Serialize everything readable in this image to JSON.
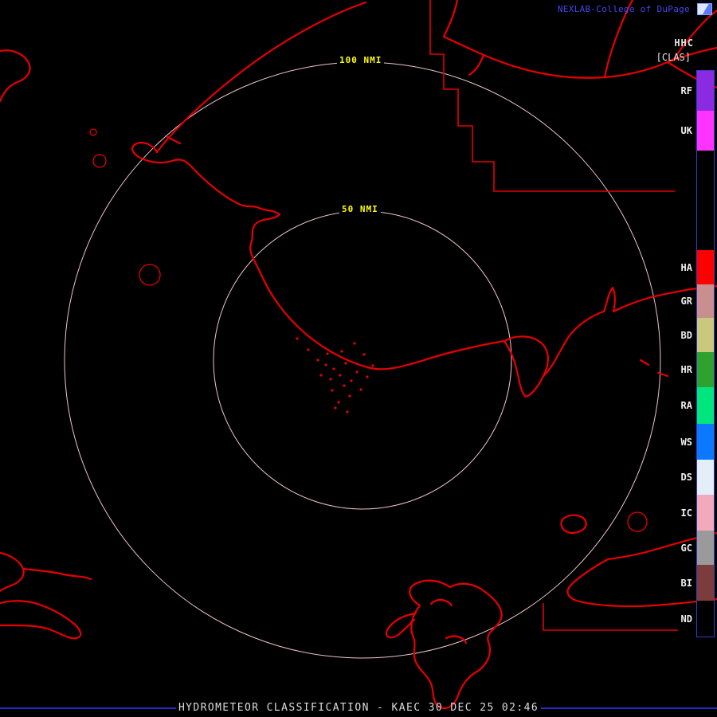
{
  "header": {
    "brand": "NEXLAB-College of DuPage",
    "brand_color": "#4646F0",
    "product_code": "HHC",
    "product_mode": "[CLAS]"
  },
  "rings": {
    "outer_label": "100 NMI",
    "inner_label": "50 NMI"
  },
  "legend": {
    "border_color": "#3A3ACC",
    "label_color": "#F0F0F0",
    "categories": [
      {
        "label": "RF",
        "color": "#8A2BE2"
      },
      {
        "label": "UK",
        "color": "#FF33FF"
      },
      {
        "label": "HA",
        "color": "#FF0000"
      },
      {
        "label": "GR",
        "color": "#C98F8F"
      },
      {
        "label": "BD",
        "color": "#C9C97D"
      },
      {
        "label": "HR",
        "color": "#2FA12F"
      },
      {
        "label": "RA",
        "color": "#00E57E"
      },
      {
        "label": "WS",
        "color": "#0A78FF"
      },
      {
        "label": "DS",
        "color": "#E4EEF8"
      },
      {
        "label": "IC",
        "color": "#F2A9BC"
      },
      {
        "label": "GC",
        "color": "#9A9A9A"
      },
      {
        "label": "BI",
        "color": "#7D3C3C"
      },
      {
        "label": "ND",
        "color": "#000000"
      }
    ]
  },
  "map": {
    "outline_color": "#E60000",
    "ring_color": "#EFC3CB",
    "ring_label_color": "#FFFF00"
  },
  "footer": {
    "title": "HYDROMETEOR CLASSIFICATION - KAEC 30 DEC 25 02:46",
    "rule_color": "#2929C8"
  }
}
